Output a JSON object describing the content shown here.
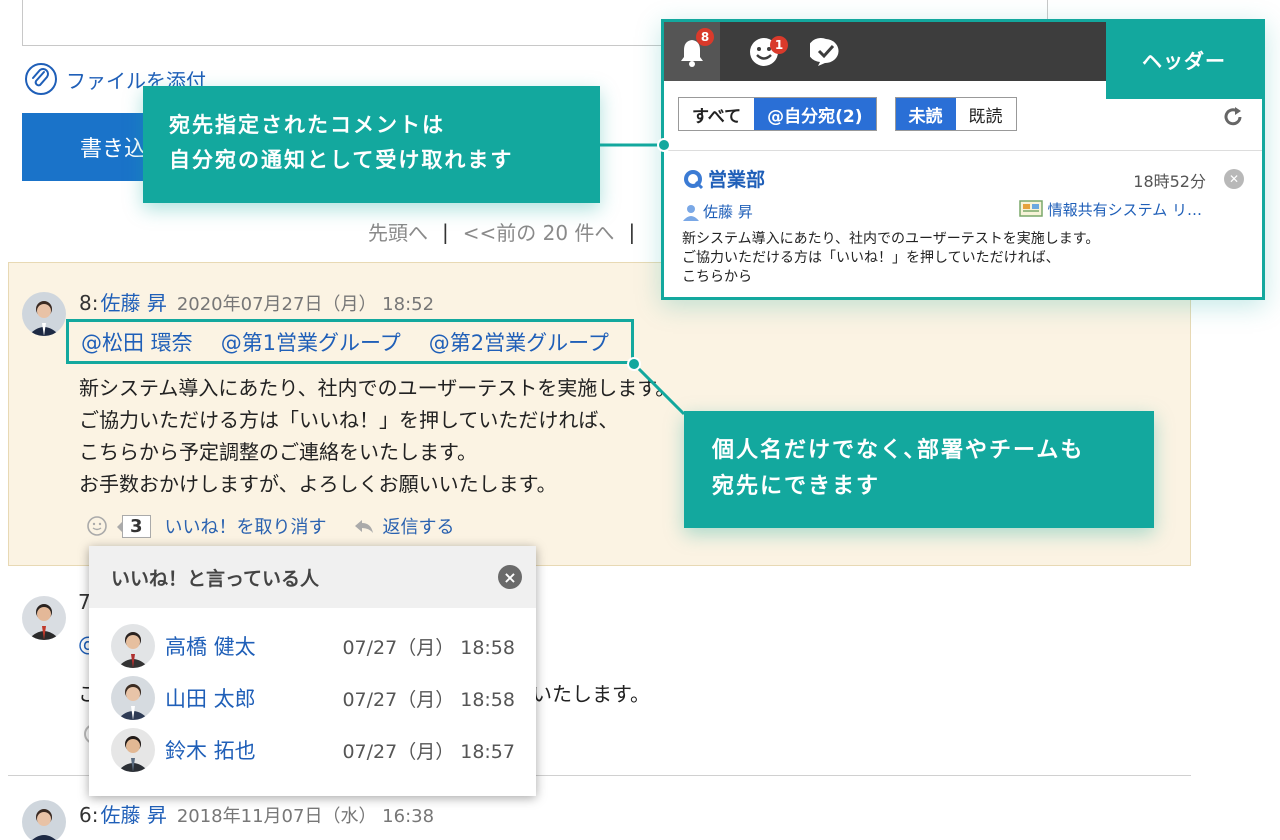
{
  "composer": {
    "attach_label": "ファイルを添付",
    "post_label": "書き込"
  },
  "pager": {
    "first": "先頭へ",
    "sep": "|",
    "prev": "<<前の 20 件へ"
  },
  "comment8": {
    "num": "8:",
    "author": "佐藤 昇",
    "date": "2020年07月27日（月） 18:52",
    "mentions": [
      "@松田 環奈",
      "@第1営業グループ",
      "@第2営業グループ"
    ],
    "lines": [
      "新システム導入にあたり、社内でのユーザーテストを実施します。",
      "ご協力いただける方は「いいね！」を押していただければ、",
      "こちらから予定調整のご連絡をいたします。",
      "お手数おかけしますが、よろしくお願いいたします。"
    ],
    "like_count": "3",
    "unlike_label": "いいね！を取り消す",
    "reply_label": "返信する"
  },
  "comment7": {
    "num": "7",
    "at": "@",
    "line_start": "こ",
    "line_tail": "いいたします。"
  },
  "comment6": {
    "num": "6:",
    "author": "佐藤 昇",
    "date": "2018年11月07日（水） 16:38"
  },
  "likes_popup": {
    "title": "いいね！と言っている人",
    "close": "×",
    "people": [
      {
        "name": "高橋 健太",
        "time": "07/27（月） 18:58"
      },
      {
        "name": "山田 太郎",
        "time": "07/27（月） 18:58"
      },
      {
        "name": "鈴木 拓也",
        "time": "07/27（月） 18:57"
      }
    ]
  },
  "notifications": {
    "bell_badge": "8",
    "smile_badge": "1",
    "filter_all": "すべて",
    "filter_mine": "@自分宛(2)",
    "filter_unread": "未読",
    "filter_read": "既読",
    "item": {
      "title": "営業部",
      "time": "18時52分",
      "user": "佐藤 昇",
      "app": "情報共有システム リ…",
      "lines": [
        "新システム導入にあたり、社内でのユーザーテストを実施します。",
        "ご協力いただける方は「いいね！」を押していただければ、",
        "こちらから"
      ]
    }
  },
  "labels": {
    "header": "ヘッダー",
    "callout1": [
      "宛先指定されたコメントは",
      "自分宛の通知として受け取れます"
    ],
    "callout2": [
      "個人名だけでなく､部署やチームも",
      "宛先にできます"
    ]
  },
  "colors": {
    "accent": "#13a89e",
    "link": "#1f5fb8",
    "primary_button": "#1a73c9",
    "highlight_bg": "#fbf3e3",
    "badge": "#d93a2b"
  }
}
